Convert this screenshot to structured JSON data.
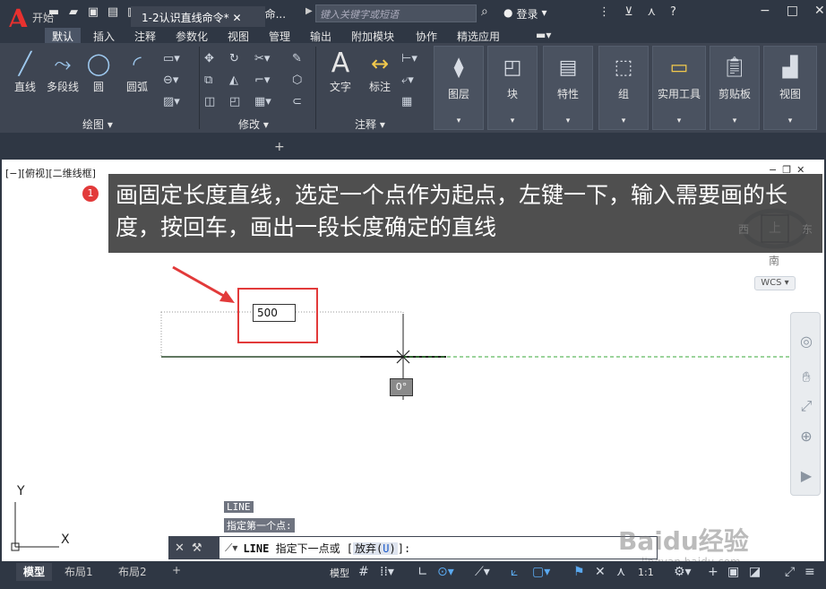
{
  "titlebar": {
    "doc_title": "1-2认识直线命...",
    "search_placeholder": "键入关键字或短语",
    "login": "登录"
  },
  "menu": {
    "tabs": [
      "默认",
      "插入",
      "注释",
      "参数化",
      "视图",
      "管理",
      "输出",
      "附加模块",
      "协作",
      "精选应用"
    ],
    "active": "默认"
  },
  "ribbon": {
    "draw": {
      "line": "直线",
      "polyline": "多段线",
      "circle": "圆",
      "arc": "圆弧",
      "panel": "绘图"
    },
    "modify": {
      "panel": "修改"
    },
    "annotate": {
      "text": "文字",
      "dim": "标注",
      "panel": "注释"
    },
    "tiles": [
      "图层",
      "块",
      "特性",
      "组",
      "实用工具",
      "剪贴板",
      "视图"
    ]
  },
  "doctabs": {
    "start": "开始",
    "current": "1-2认识直线命令*"
  },
  "viewport": {
    "label": "[−][俯视][二维线框]",
    "viewcube": {
      "west": "西",
      "top": "上",
      "east": "东",
      "south": "南"
    },
    "wcs": "WCS"
  },
  "callout": {
    "badge": "1",
    "text": "画固定长度直线，选定一个点作为起点，左键一下，输入需要画的长度，按回车，画出一段长度确定的直线"
  },
  "drawing": {
    "length_value": "500",
    "angle": "0°",
    "ucs_y": "Y",
    "ucs_x": "X"
  },
  "command": {
    "history1": "LINE",
    "history2": "指定第一个点:",
    "cmd_name": "LINE",
    "prompt": " 指定下一点或 [",
    "option_key": "U",
    "option_pre": "放弃(",
    "option_post": ")",
    "prompt_end": "]:"
  },
  "status": {
    "tabs": [
      "模型",
      "布局1",
      "布局2"
    ],
    "model": "模型",
    "scale": "1:1"
  },
  "watermark": {
    "main": "Baidu经验",
    "sub": "jingyan.baidu.com"
  }
}
